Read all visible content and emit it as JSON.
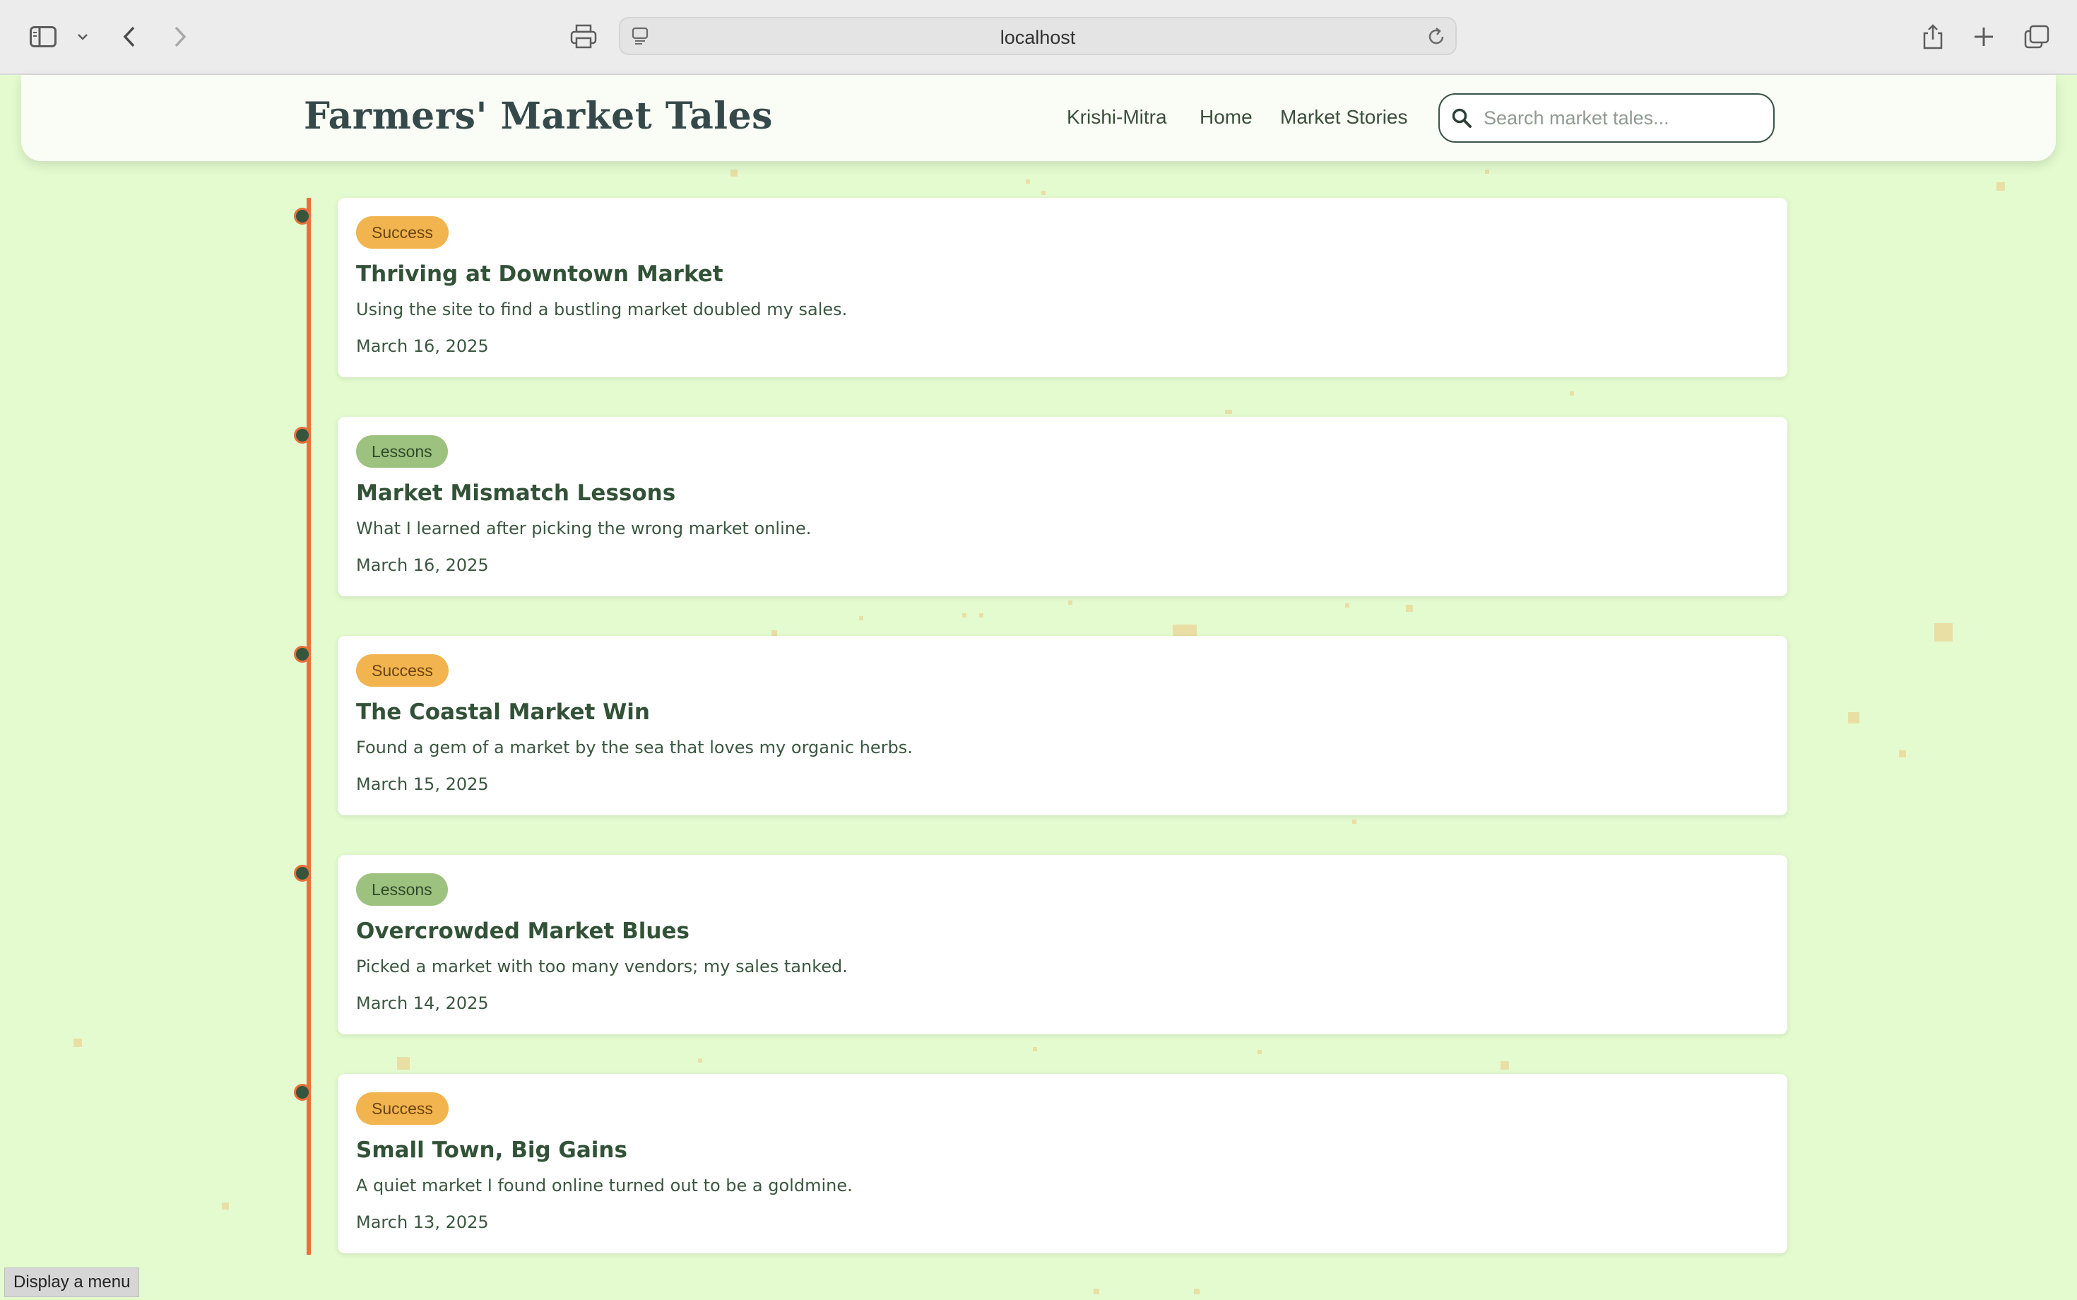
{
  "browser": {
    "url": "localhost"
  },
  "header": {
    "logo": "Farmers' Market Tales",
    "nav": [
      "Krishi-Mitra",
      "Home",
      "Market Stories"
    ],
    "search_placeholder": "Search market tales..."
  },
  "stories": [
    {
      "tag": "Success",
      "title": "Thriving at Downtown Market",
      "description": "Using the site to find a bustling market doubled my sales.",
      "date": "March 16, 2025"
    },
    {
      "tag": "Lessons",
      "title": "Market Mismatch Lessons",
      "description": "What I learned after picking the wrong market online.",
      "date": "March 16, 2025"
    },
    {
      "tag": "Success",
      "title": "The Coastal Market Win",
      "description": "Found a gem of a market by the sea that loves my organic herbs.",
      "date": "March 15, 2025"
    },
    {
      "tag": "Lessons",
      "title": "Overcrowded Market Blues",
      "description": "Picked a market with too many vendors; my sales tanked.",
      "date": "March 14, 2025"
    },
    {
      "tag": "Success",
      "title": "Small Town, Big Gains",
      "description": "A quiet market I found online turned out to be a goldmine.",
      "date": "March 13, 2025"
    }
  ],
  "tooltip": "Display a menu",
  "colors": {
    "background": "#e4fbcf",
    "timeline": "#e8703a",
    "success_badge": "#f2b44e",
    "lessons_badge": "#9dc17e",
    "title_text": "#325237"
  }
}
